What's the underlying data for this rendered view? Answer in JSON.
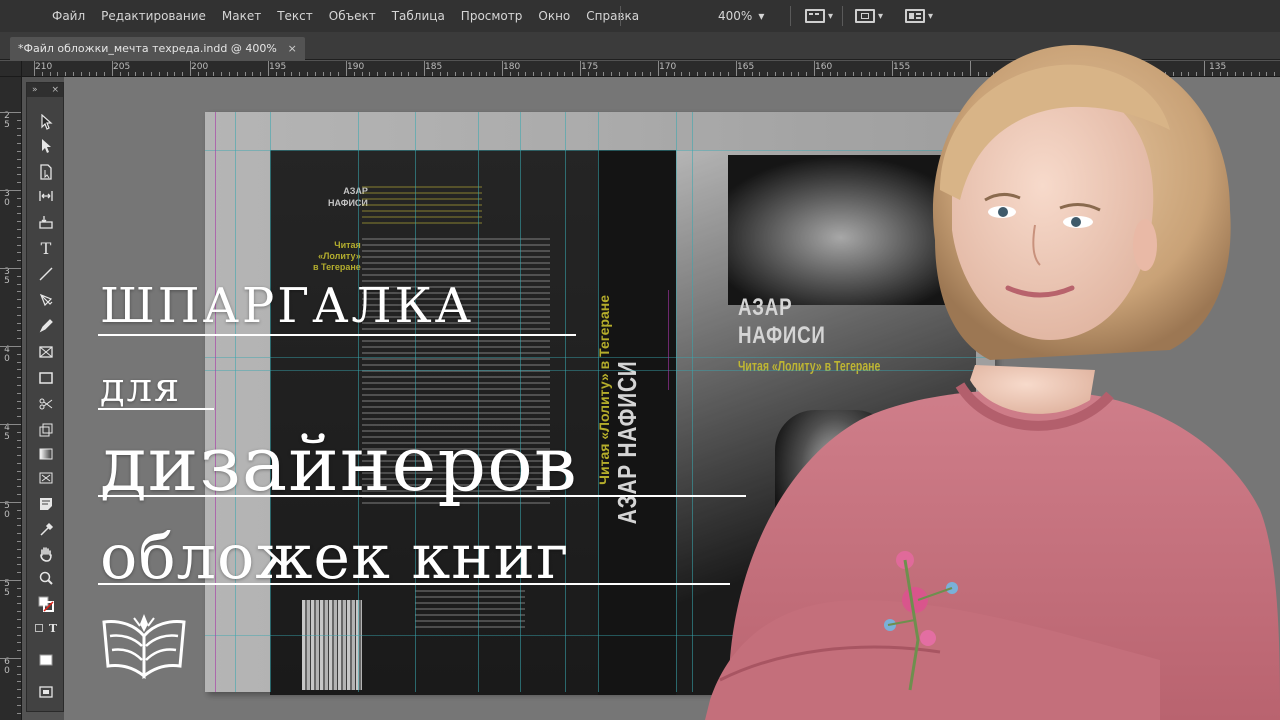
{
  "menu": {
    "items": [
      "Файл",
      "Редактирование",
      "Макет",
      "Текст",
      "Объект",
      "Таблица",
      "Просмотр",
      "Окно",
      "Справка"
    ],
    "zoom": "400%"
  },
  "tab": {
    "title": "*Файл обложки_мечта техреда.indd @ 400%",
    "close": "×"
  },
  "ruler": {
    "h_labels": [
      "210",
      "205",
      "200",
      "195",
      "190",
      "185",
      "180",
      "175",
      "170",
      "165",
      "160",
      "155",
      "135"
    ],
    "v_labels": [
      "2 5",
      "3 0",
      "3 5",
      "4 0",
      "4 5",
      "5 0",
      "5 5",
      "6 0"
    ]
  },
  "tools": {
    "header": "»",
    "close": "×",
    "icons": [
      "selection-tool",
      "direct-selection-tool",
      "page-tool",
      "gap-tool",
      "content-collector-tool",
      "type-tool",
      "line-tool",
      "pen-tool",
      "pencil-tool",
      "rectangle-frame-tool",
      "rectangle-tool",
      "scissors-tool",
      "free-transform-tool",
      "gradient-swatch-tool",
      "gradient-feather-tool",
      "note-tool",
      "eyedropper-tool",
      "hand-tool",
      "zoom-tool",
      "fill-stroke",
      "apply-color",
      "screen-mode",
      "normal-mode"
    ]
  },
  "document": {
    "author": "АЗАР\nНАФИСИ",
    "subtitle": "Читая «Лолиту» в Тегеране",
    "spine_author": "АЗАР НАФИСИ",
    "spine_title": "Читая «Лолиту» в Тегеране",
    "back_author": "АЗАР\nНАФИСИ",
    "back_title": "Читая\n«Лолиту»\nв Тегеране"
  },
  "headline": {
    "line1": "ШПАРГАЛКА",
    "line2": "для",
    "line3": "дизайнеров",
    "line4": "обложек книг"
  }
}
